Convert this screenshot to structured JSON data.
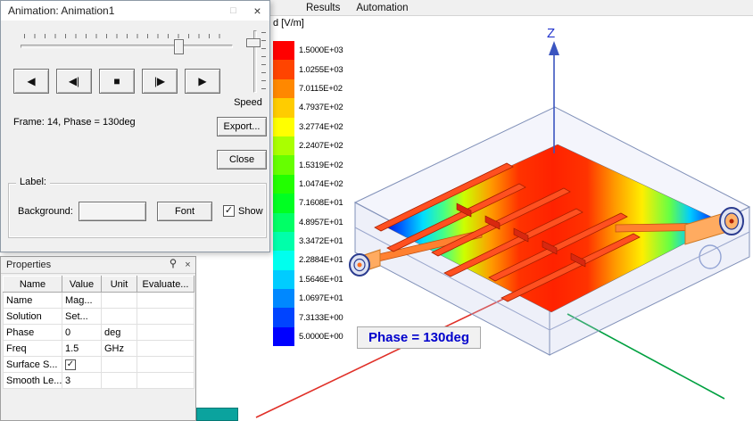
{
  "menu_bar": {
    "items": [
      {
        "label": "Results"
      },
      {
        "label": "Automation"
      }
    ]
  },
  "animation_dialog": {
    "title": "Animation: Animation1",
    "frame_status": "Frame: 14, Phase = 130deg",
    "speed_label": "Speed",
    "window_buttons": {
      "maximize_icon": "□",
      "close_icon": "×"
    },
    "playback": {
      "play_reverse": "◀",
      "step_back": "◀|",
      "stop": "■",
      "step_forward": "|▶",
      "play_forward": "▶"
    },
    "buttons": {
      "export": "Export...",
      "close": "Close"
    },
    "label_group": {
      "title": "Label:",
      "background_label": "Background:",
      "font_button": "Font",
      "show_label": "Show",
      "show_checked": true
    }
  },
  "properties_panel": {
    "title": "Properties",
    "pin_icon": "pin",
    "close_icon": "×",
    "columns": [
      "Name",
      "Value",
      "Unit",
      "Evaluate..."
    ],
    "rows": [
      {
        "name": "Name",
        "value": "Mag...",
        "unit": "",
        "evaluated": "",
        "type": "text"
      },
      {
        "name": "Solution",
        "value": "Set...",
        "unit": "",
        "evaluated": "",
        "type": "text"
      },
      {
        "name": "Phase",
        "value": "0",
        "unit": "deg",
        "evaluated": "",
        "type": "text"
      },
      {
        "name": "Freq",
        "value": "1.5",
        "unit": "GHz",
        "evaluated": "",
        "type": "text"
      },
      {
        "name": "Surface S...",
        "value": true,
        "unit": "",
        "evaluated": "",
        "type": "checkbox"
      },
      {
        "name": "Smooth Le...",
        "value": "3",
        "unit": "",
        "evaluated": "",
        "type": "text"
      }
    ]
  },
  "legend": {
    "title": "d [V/m]",
    "entries": [
      {
        "value": "1.5000E+03",
        "color": "#ff0000"
      },
      {
        "value": "1.0255E+03",
        "color": "#ff4400"
      },
      {
        "value": "7.0115E+02",
        "color": "#ff8800"
      },
      {
        "value": "4.7937E+02",
        "color": "#ffcc00"
      },
      {
        "value": "3.2774E+02",
        "color": "#ffff00"
      },
      {
        "value": "2.2407E+02",
        "color": "#aaff00"
      },
      {
        "value": "1.5319E+02",
        "color": "#66ff00"
      },
      {
        "value": "1.0474E+02",
        "color": "#22ff00"
      },
      {
        "value": "7.1608E+01",
        "color": "#00ff22"
      },
      {
        "value": "4.8957E+01",
        "color": "#00ff66"
      },
      {
        "value": "3.3472E+01",
        "color": "#00ffaa"
      },
      {
        "value": "2.2884E+01",
        "color": "#00ffee"
      },
      {
        "value": "1.5646E+01",
        "color": "#00ccff"
      },
      {
        "value": "1.0697E+01",
        "color": "#0088ff"
      },
      {
        "value": "7.3133E+00",
        "color": "#0044ff"
      },
      {
        "value": "5.0000E+00",
        "color": "#0000ff"
      }
    ]
  },
  "viewport": {
    "phase_annotation": "Phase = 130deg",
    "axes": {
      "x_color": "#e03028",
      "y_color": "#00a040",
      "z_color": "#3a55c0",
      "z_label": "Z"
    }
  }
}
